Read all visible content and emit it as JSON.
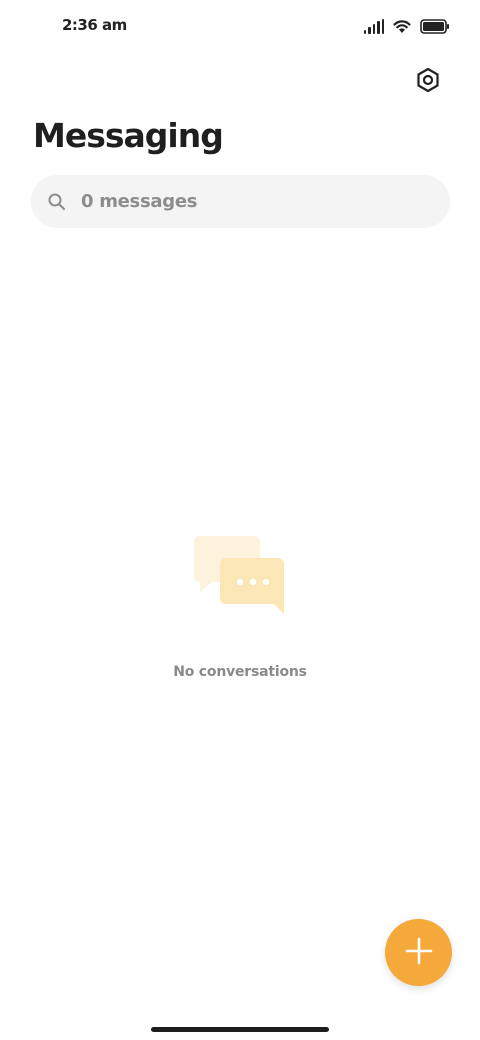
{
  "status_bar": {
    "time": "2:36 am"
  },
  "header": {
    "title": "Messaging",
    "settings_icon": "settings-icon"
  },
  "search": {
    "placeholder": "0 messages",
    "icon": "search-icon"
  },
  "empty_state": {
    "icon": "conversations-icon",
    "text": "No conversations"
  },
  "fab": {
    "icon": "plus-icon"
  },
  "colors": {
    "accent": "#f6a93b",
    "empty_icon_light": "#fdf3dd",
    "empty_icon_dark": "#fbe6b6",
    "text_primary": "#1f1f1f",
    "text_muted": "#8a8a8a",
    "search_bg": "#f4f4f4"
  }
}
